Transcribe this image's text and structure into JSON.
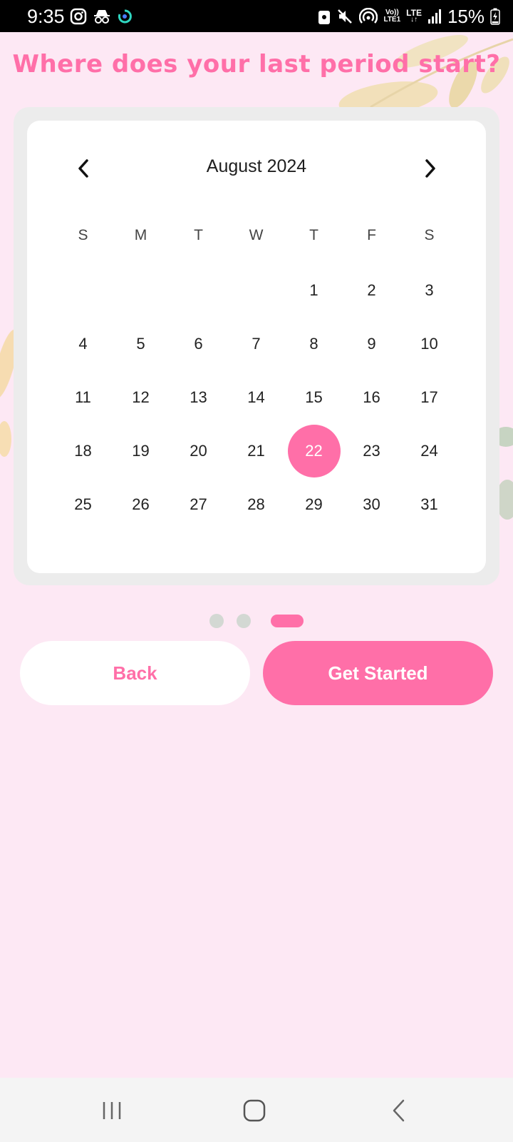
{
  "status_bar": {
    "time": "9:35",
    "battery": "15%",
    "left_icons": [
      "instagram-icon",
      "incognito-icon",
      "sync-icon"
    ],
    "right_icons": [
      "screenshot-lock-icon",
      "mute-icon",
      "hotspot-icon",
      "volte-icon",
      "lte-icon",
      "signal-icon",
      "battery-charging-icon"
    ],
    "volte_top": "Vo))",
    "volte_bottom": "LTE1",
    "lte_label": "LTE"
  },
  "title": "Where does your last period start?",
  "calendar": {
    "month_label": "August 2024",
    "weekdays": [
      "S",
      "M",
      "T",
      "W",
      "T",
      "F",
      "S"
    ],
    "leading_blanks": 4,
    "days": [
      "1",
      "2",
      "3",
      "4",
      "5",
      "6",
      "7",
      "8",
      "9",
      "10",
      "11",
      "12",
      "13",
      "14",
      "15",
      "16",
      "17",
      "18",
      "19",
      "20",
      "21",
      "22",
      "23",
      "24",
      "25",
      "26",
      "27",
      "28",
      "29",
      "30",
      "31"
    ],
    "selected_day": "22"
  },
  "pager": {
    "total": 3,
    "active_index": 2
  },
  "buttons": {
    "back_label": "Back",
    "start_label": "Get Started"
  },
  "colors": {
    "accent": "#ff6fa8",
    "background": "#fde8f4",
    "card_frame": "#ececec",
    "dot_inactive": "#d3d8d3"
  }
}
